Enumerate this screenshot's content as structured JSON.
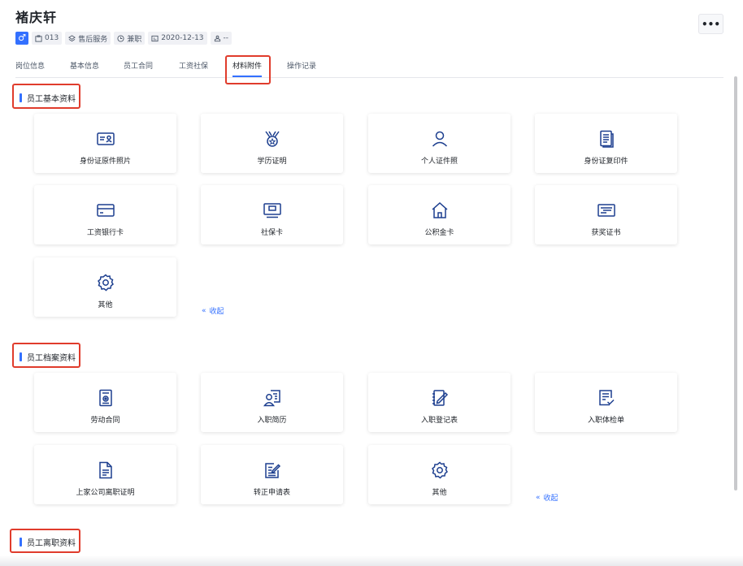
{
  "employee": {
    "name": "褚庆轩",
    "gender_icon": "male-icon",
    "tags": [
      {
        "icon": "badge-icon",
        "text": "013"
      },
      {
        "icon": "layers-icon",
        "text": "售后服务"
      },
      {
        "icon": "clock-icon",
        "text": "兼职"
      },
      {
        "icon": "calendar-icon",
        "text": "2020-12-13"
      },
      {
        "icon": "person-outline-icon",
        "text": "--"
      }
    ]
  },
  "more_button": "•••",
  "tabs": [
    "岗位信息",
    "基本信息",
    "员工合同",
    "工资社保",
    "材料附件",
    "操作记录"
  ],
  "active_tab": "材料附件",
  "sections": [
    {
      "title": "员工基本资料",
      "items": [
        {
          "label": "身份证原件照片",
          "icon": "id-card-icon"
        },
        {
          "label": "学历证明",
          "icon": "medal-icon"
        },
        {
          "label": "个人证件照",
          "icon": "person-icon"
        },
        {
          "label": "身份证复印件",
          "icon": "document-copy-icon"
        },
        {
          "label": "工资银行卡",
          "icon": "bank-card-icon"
        },
        {
          "label": "社保卡",
          "icon": "social-card-icon"
        },
        {
          "label": "公积金卡",
          "icon": "house-icon"
        },
        {
          "label": "获奖证书",
          "icon": "certificate-icon"
        },
        {
          "label": "其他",
          "icon": "gear-icon"
        }
      ],
      "collapse_label": "收起"
    },
    {
      "title": "员工档案资料",
      "items": [
        {
          "label": "劳动合同",
          "icon": "contract-icon"
        },
        {
          "label": "入职简历",
          "icon": "resume-icon"
        },
        {
          "label": "入职登记表",
          "icon": "registration-form-icon"
        },
        {
          "label": "入职体检单",
          "icon": "medical-check-icon"
        },
        {
          "label": "上家公司离职证明",
          "icon": "file-icon"
        },
        {
          "label": "转正申请表",
          "icon": "edit-form-icon"
        },
        {
          "label": "其他",
          "icon": "gear-icon"
        }
      ],
      "collapse_label": "收起"
    },
    {
      "title": "员工离职资料",
      "items": []
    }
  ],
  "colors": {
    "accent": "#3370ff",
    "highlight": "#e03c2c"
  }
}
